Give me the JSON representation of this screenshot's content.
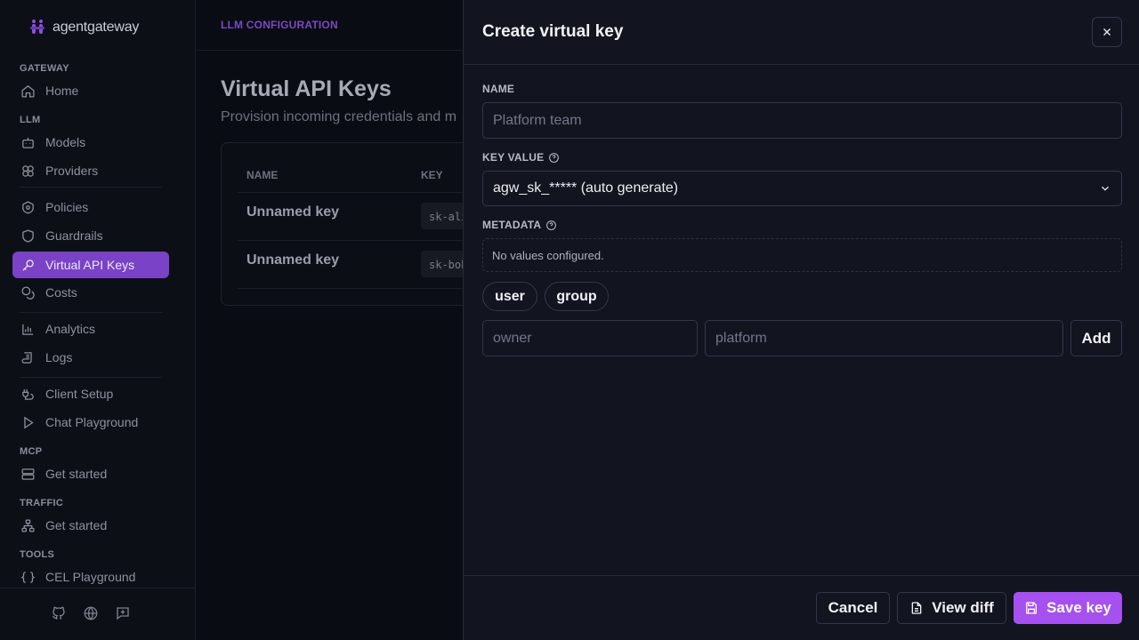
{
  "brand": {
    "name": "agentgateway"
  },
  "sidebar": {
    "sections": {
      "gateway": "GATEWAY",
      "llm": "LLM",
      "mcp": "MCP",
      "traffic": "TRAFFIC",
      "tools": "TOOLS"
    },
    "items": {
      "home": "Home",
      "models": "Models",
      "providers": "Providers",
      "policies": "Policies",
      "guardrails": "Guardrails",
      "virtual_keys": "Virtual API Keys",
      "costs": "Costs",
      "analytics": "Analytics",
      "logs": "Logs",
      "client_setup": "Client Setup",
      "chat_playground": "Chat Playground",
      "mcp_get_started": "Get started",
      "traffic_get_started": "Get started",
      "cel_playground": "CEL Playground"
    },
    "active_item": "Virtual API Keys",
    "footer_icons": [
      "github-icon",
      "globe-icon",
      "feedback-icon"
    ]
  },
  "main": {
    "breadcrumb": "LLM CONFIGURATION",
    "title": "Virtual API Keys",
    "subtitle": "Provision incoming credentials and m",
    "table": {
      "columns": [
        "NAME",
        "KEY"
      ],
      "rows": [
        {
          "name": "Unnamed key",
          "key": "sk-alice"
        },
        {
          "name": "Unnamed key",
          "key": "sk-bob"
        }
      ]
    }
  },
  "drawer": {
    "title": "Create virtual key",
    "name_label": "NAME",
    "name_placeholder": "Platform team",
    "key_value_label": "KEY VALUE",
    "key_value_selected": "agw_sk_***** (auto generate)",
    "metadata_label": "METADATA",
    "metadata_empty": "No values configured.",
    "chips": [
      "user",
      "group"
    ],
    "meta_key_placeholder": "owner",
    "meta_value_placeholder": "platform",
    "add_label": "Add",
    "cancel_label": "Cancel",
    "view_diff_label": "View diff",
    "save_label": "Save key"
  },
  "colors": {
    "accent": "#a550ef",
    "active_nav": "#7a42c7",
    "breadcrumb": "#7b49c4"
  }
}
